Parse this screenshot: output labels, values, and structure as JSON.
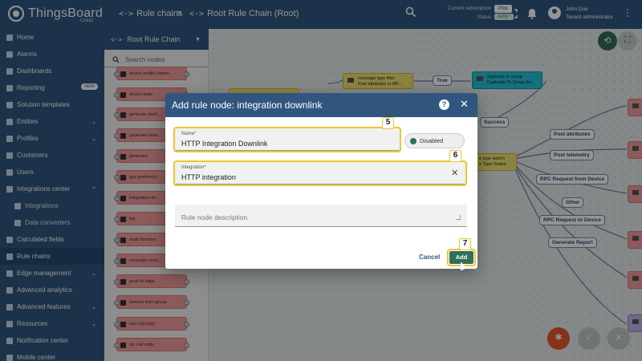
{
  "app": {
    "brand": "ThingsBoard",
    "edition": "Cloud"
  },
  "header": {
    "crumb1": "Rule chains",
    "crumb_sep": ">",
    "crumb2": "Root Rule Chain (Root)",
    "subscription_label": "Current subscription",
    "subscription_value": "Pilot",
    "status_label": "Status",
    "status_value": "Active",
    "user_name": "John Doe",
    "user_role": "Tenant administrator"
  },
  "sidebar": {
    "items": [
      {
        "label": "Home"
      },
      {
        "label": "Alarms"
      },
      {
        "label": "Dashboards"
      },
      {
        "label": "Reporting",
        "badge": "NEW"
      },
      {
        "label": "Solution templates"
      },
      {
        "label": "Entities"
      },
      {
        "label": "Profiles"
      },
      {
        "label": "Customers"
      },
      {
        "label": "Users"
      },
      {
        "label": "Integrations center"
      },
      {
        "label": "Integrations"
      },
      {
        "label": "Data converters"
      },
      {
        "label": "Calculated fields"
      },
      {
        "label": "Rule chains"
      },
      {
        "label": "Edge management"
      },
      {
        "label": "Advanced analytics"
      },
      {
        "label": "Advanced features"
      },
      {
        "label": "Resources"
      },
      {
        "label": "Notification center"
      },
      {
        "label": "Mobile center"
      }
    ]
  },
  "library": {
    "title": "Root Rule Chain",
    "search_placeholder": "Search nodes",
    "nodes": [
      "device profile (depre...",
      "device state",
      "generate dash...",
      "generate repor...",
      "generator",
      "gps geofencin...",
      "integration do...",
      "log",
      "math function",
      "message coun...",
      "push to edge",
      "remove from group",
      "rest call reply",
      "rpc call reply"
    ]
  },
  "canvas": {
    "filter_node": {
      "title": "message type filter",
      "sub": "Post attributes or RP..."
    },
    "group_node": {
      "title": "duplicate to group",
      "sub": "Duplicate To Group En..."
    },
    "switch_node": {
      "title": "e type switch",
      "sub": "e Type Switch"
    },
    "labels": {
      "true": "True",
      "success": "Success",
      "post_attributes": "Post attributes",
      "post_telemetry": "Post telemetry",
      "rpc_from_device": "RPC Request from Device",
      "other": "Other",
      "rpc_to_device": "RPC Request to Device",
      "generate_report": "Generate Report"
    }
  },
  "dialog": {
    "title": "Add rule node: integration downlink",
    "name_label": "Name*",
    "name_value": "HTTP Integration Downlink",
    "toggle_label": "Disabled",
    "integration_label": "Integration*",
    "integration_value": "HTTP integration",
    "description_placeholder": "Rule node description",
    "cancel": "Cancel",
    "add": "Add",
    "step_name": "5",
    "step_integration": "6",
    "step_add": "7"
  },
  "colors": {
    "primary": "#305680",
    "accent": "#2f6f5a",
    "highlight": "#f0c430"
  }
}
